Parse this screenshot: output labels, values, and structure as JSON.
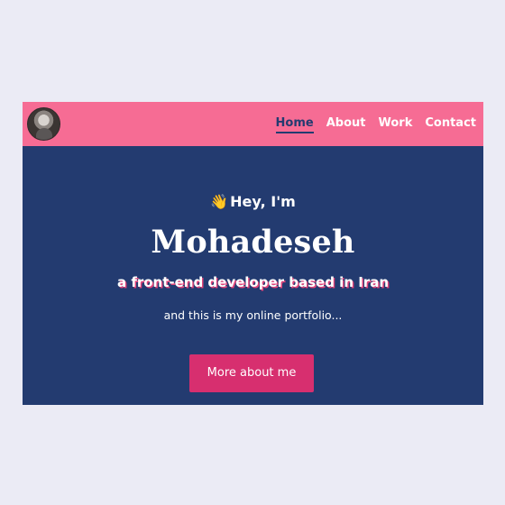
{
  "nav": {
    "avatar_label": "",
    "links": [
      {
        "label": "Home",
        "active": true
      },
      {
        "label": "About",
        "active": false
      },
      {
        "label": "Work",
        "active": false
      },
      {
        "label": "Contact",
        "active": false
      }
    ]
  },
  "hero": {
    "greeting": "Hey, I'm",
    "greeting_icon": "waving-hand-icon",
    "name": "Mohadeseh",
    "tagline": "a front-end developer based in Iran",
    "subtitle": "and this is my online portfolio...",
    "cta_label": "More about me"
  },
  "colors": {
    "page_background": "#ebebf5",
    "nav_background": "#f66c94",
    "hero_background": "#233b70",
    "accent": "#d72f6f",
    "text_primary": "#ffffff"
  }
}
